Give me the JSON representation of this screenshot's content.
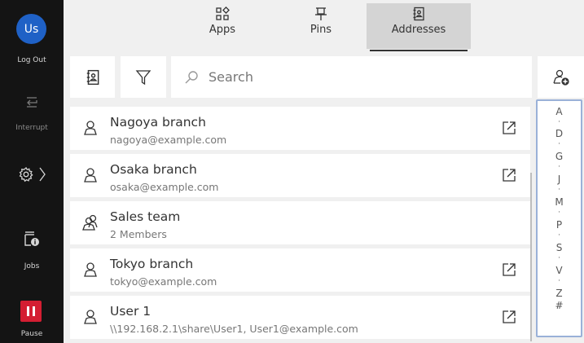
{
  "rail": {
    "avatar_initials": "Us",
    "logout_label": "Log Out",
    "interrupt_label": "Interrupt",
    "jobs_label": "Jobs",
    "pause_label": "Pause",
    "icons": [
      "interrupt-icon",
      "gear-icon",
      "chevron-right-icon",
      "jobs-icon",
      "pause-icon"
    ]
  },
  "tabs": [
    {
      "label": "Apps",
      "icon": "apps-grid-icon",
      "active": false
    },
    {
      "label": "Pins",
      "icon": "pin-icon",
      "active": false
    },
    {
      "label": "Addresses",
      "icon": "address-book-icon",
      "active": true
    }
  ],
  "toolbar": {
    "icons": [
      "address-book-icon",
      "filter-icon",
      "search-icon",
      "add-contact-icon"
    ],
    "search_placeholder": "Search"
  },
  "contacts": [
    {
      "name": "Nagoya branch",
      "sub": "nagoya@example.com",
      "type": "person",
      "external": true
    },
    {
      "name": "Osaka branch",
      "sub": "osaka@example.com",
      "type": "person",
      "external": true
    },
    {
      "name": "Sales team",
      "sub": "2 Members",
      "type": "group",
      "external": false
    },
    {
      "name": "Tokyo branch",
      "sub": "tokyo@example.com",
      "type": "person",
      "external": true
    },
    {
      "name": "User 1",
      "sub": "\\\\192.168.2.1\\share\\User1, User1@example.com",
      "type": "person",
      "external": true
    }
  ],
  "alpha_index": [
    "A",
    "·",
    "D",
    "·",
    "G",
    "·",
    "J",
    "·",
    "M",
    "·",
    "P",
    "·",
    "S",
    "·",
    "V",
    "·",
    "Z",
    "#"
  ],
  "colors": {
    "rail_bg": "#141414",
    "avatar": "#1f61c6",
    "pause": "#d41e32",
    "index_border": "#9ab1d8",
    "active_tab": "#d4d4d4"
  }
}
